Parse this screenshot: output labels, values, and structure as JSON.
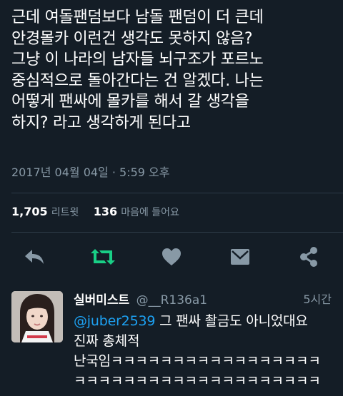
{
  "tweet": {
    "lines": [
      "근데 여돌팬덤보다 남돌 팬덤이 더 큰데",
      "안경몰카 이런건 생각도 못하지 않음?",
      "그냥 이 나라의 남자들 뇌구조가 포르노",
      "중심적으로 돌아간다는 건 알겠다. 나는",
      "어떻게 팬싸에 몰카를 해서 갈 생각을",
      "하지? 라고 생각하게 된다고"
    ],
    "timestamp": "2017년 04월 04일 · 5:59 오후",
    "retweet_count": "1,705",
    "retweet_label": "리트윗",
    "like_count": "136",
    "like_label": "마음에 들어요"
  },
  "actions": {
    "reply": "reply-icon",
    "retweet": "retweet-icon",
    "like": "heart-icon",
    "message": "envelope-icon",
    "share": "share-icon"
  },
  "reply": {
    "name": "실버미스트",
    "handle": "@__R136a1",
    "age": "5시간",
    "mention": "@juber2539",
    "line1_rest": " 그 팬싸 촬금도 아니었대요",
    "line2": "진짜 총체적",
    "line3": "난국임ㅋㅋㅋㅋㅋㅋㅋㅋㅋㅋㅋㅋㅋㅋㅋㅋㅋ",
    "line4": "ㅋㅋㅋㅋㅋㅋㅋㅋㅋㅋㅋㅋㅋㅋㅋㅋㅋㅋㅋㅋ"
  },
  "colors": {
    "background": "#141d26",
    "secondary_text": "#8899a6",
    "retweet_green": "#19cf86",
    "link_blue": "#1da1f2"
  }
}
